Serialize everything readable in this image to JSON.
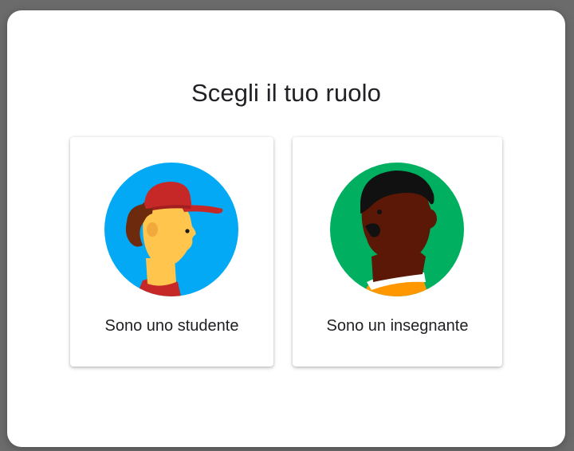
{
  "dialog": {
    "title": "Scegli il tuo ruolo",
    "roles": [
      {
        "id": "student",
        "label": "Sono uno studente",
        "icon": "student-avatar-icon",
        "circle_color": "#03a9f4"
      },
      {
        "id": "teacher",
        "label": "Sono un insegnante",
        "icon": "teacher-avatar-icon",
        "circle_color": "#00b060"
      }
    ]
  },
  "colors": {
    "backdrop": "#6b6b6b",
    "dialog_bg": "#ffffff",
    "text": "#202124"
  }
}
